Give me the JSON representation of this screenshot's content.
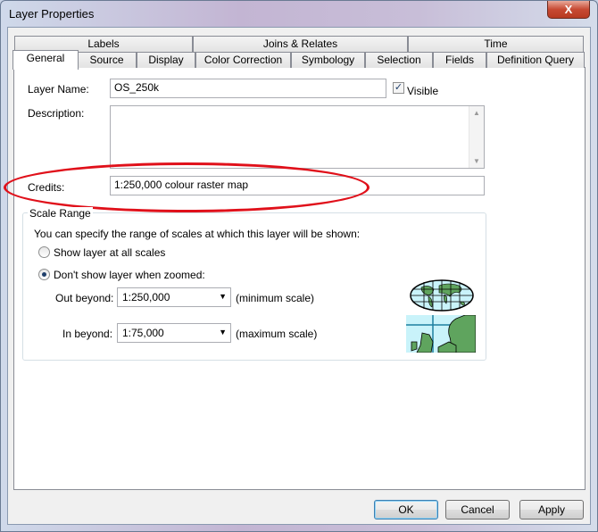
{
  "window": {
    "title": "Layer Properties",
    "close_label": "X"
  },
  "tabs_row1": [
    "Labels",
    "Joins & Relates",
    "Time"
  ],
  "tabs_row2": [
    "General",
    "Source",
    "Display",
    "Color Correction",
    "Symbology",
    "Selection",
    "Fields",
    "Definition Query"
  ],
  "selected_tab": "General",
  "general": {
    "layer_name_label": "Layer Name:",
    "layer_name_value": "OS_250k",
    "visible_label": "Visible",
    "visible_checked": true,
    "description_label": "Description:",
    "description_value": "",
    "credits_label": "Credits:",
    "credits_value": "1:250,000 colour raster map",
    "highlight_color": "#e0101a"
  },
  "scale_range": {
    "title": "Scale Range",
    "instruction": "You can specify the range of scales at which this layer will be shown:",
    "option_all": "Show layer at all scales",
    "option_zoomed": "Don't show layer when zoomed:",
    "selected_option": "zoomed",
    "out_beyond_label": "Out beyond:",
    "out_beyond_value": "1:250,000",
    "out_beyond_hint": "(minimum scale)",
    "in_beyond_label": "In beyond:",
    "in_beyond_value": "1:75,000",
    "in_beyond_hint": "(maximum scale)"
  },
  "buttons": {
    "ok": "OK",
    "cancel": "Cancel",
    "apply": "Apply"
  }
}
